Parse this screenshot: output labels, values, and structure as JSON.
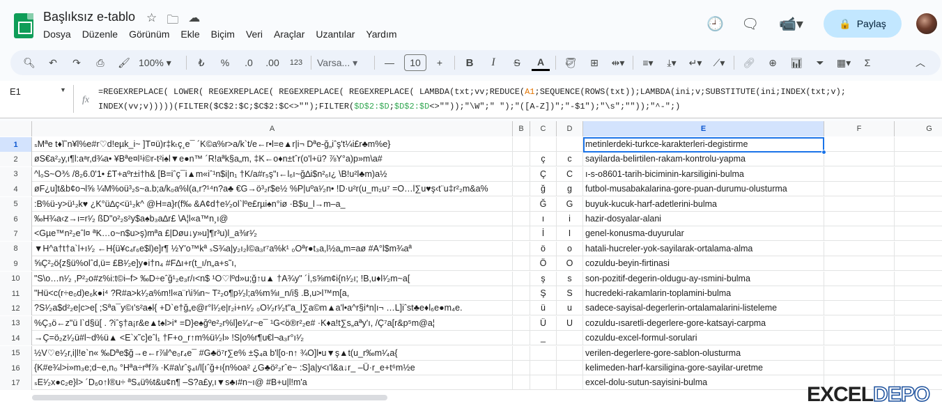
{
  "app": {
    "title": "Başlıksız e-tablo",
    "menus": [
      "Dosya",
      "Düzenle",
      "Görünüm",
      "Ekle",
      "Biçim",
      "Veri",
      "Araçlar",
      "Uzantılar",
      "Yardım"
    ],
    "share_label": "Paylaş"
  },
  "toolbar": {
    "zoom": "100%",
    "currency": "₺",
    "percent": "%",
    "dec_decrease": ".0",
    "dec_increase": ".00",
    "number_format": "123",
    "font": "Varsa...",
    "font_size": "10",
    "bold": "B",
    "italic": "I",
    "strike": "S",
    "text_color": "A"
  },
  "formula_bar": {
    "cell_ref": "E1",
    "fx": "fx",
    "line1_a": "=REGEXREPLACE( LOWER( REGEXREPLACE( REGEXREPLACE( REGEXREPLACE( LAMBDA(txt;vv;REDUCE(",
    "line1_ref": "A1",
    "line1_b": ";SEQUENCE(ROWS(txt));LAMBDA(ini;v;SUBSTITUTE(ini;INDEX(txt;v);",
    "line2_a": "INDEX(vv;v)))))(FILTER($C$2:$C;$C$2:$C<>\"\");FILTER(",
    "line2_ref1": "$D$2:$D",
    "line2_b": ";",
    "line2_ref2": "$D$2:$D",
    "line2_c": "<>\"\"));\"\\W\";\" \");\"([A-Z])\";\"-$1\");\"\\s\";\"\"));\"^-\";)"
  },
  "columns": [
    "A",
    "B",
    "C",
    "D",
    "E",
    "F",
    "G"
  ],
  "rows": [
    {
      "n": "1",
      "a": "ₛMªe t♦ĭˆn¥l%e#r♡d!eµk_i~ ]T¤ü)r‡kₜç¸e¯ ´K©a%r>a/k`t/e←r•l=e▲r|i¬ Dªe-ğ„iˆş't¼i£r♣m%e}",
      "c": "",
      "d": "",
      "e": "metinlerdeki-turkce-karakterleri-degistirme"
    },
    {
      "n": "2",
      "a": "øS€a²₂y,ı¶l:aᵃr,d¾a• ¥Bªe¤l¹i©r-t²i♠l▼e●n™ ´R!aªk§a„m, ‡K←o♦n±tˆr(o'l+ü? ⅞Y°a)p»m\\a#",
      "c": "ç",
      "d": "c",
      "e": "sayilarda-belirtilen-rakam-kontrolu-yapma"
    },
    {
      "n": "3",
      "a": "^l₀S~O⅗ /8₂6.0'1• £T+aºr±i†h& [B=iˆç¯i▲m«iˆ¹n$i|n₁ †K/a#r₅ş\"ı←l₆ı~ğ∆i$n²₆ı¿ \\B!u²l♣m)a½",
      "c": "Ç",
      "d": "C",
      "e": "ı-s-o8601-tarih-biciminin-karsiligini-bulma"
    },
    {
      "n": "4",
      "a": "øF¿u]t&b¢o¬l⅝ ¼M%oü³₂s~a.b;a/k₀a%l(a,r?¹⁴n?a♣ €G→ö³₂r$e½ %P|uºa¹⁄₂n• !D·u²r(u_m₂u⁷ =O…l∑u♥ş‹t¨u‡r²₂m&a%",
      "c": "ğ",
      "d": "g",
      "e": "futbol-musabakalarina-gore-puan-durumu-olusturma"
    },
    {
      "n": "5",
      "a": ":B%ü-y>ü¹₂k♥ ¿K°ü∆ç<ü¹₂k^ @H=a}r(f‰ &A¢d†e¹⁄₂ol`lºe£rµi♠n°iø ·B$u_l→m–a_",
      "c": "Ğ",
      "d": "G",
      "e": "buyuk-kucuk-harf-adetlerini-bulma"
    },
    {
      "n": "6",
      "a": "‰H¾a‹z→ı=r¹⁄₂ ßD\"o²₂s²y$a♠b₃a∆r£ \\A¦l«a™n¸ı@",
      "c": "ı",
      "d": "i",
      "e": "hazir-dosyalar-alani"
    },
    {
      "n": "7",
      "a": "<Gµe™n²₂eˆl¤ ªK…o~n$u>ş)mªa £|Døu↓y»u]¶r³u)l_a⅜r¹⁄₂",
      "c": "İ",
      "d": "I",
      "e": "genel-konusma-duyurular"
    },
    {
      "n": "8",
      "a": "▼H^a†t†a`l+ı¹⁄₂ ←H{ü¥c₄r₆e$l)e]r¶ ½Y'o™kª ₛS¾a|y₂ı₂l©a₃r⁷a%k¹ ₀Oªr●t₃a,l½a„m=aø #A°l$m¾aª",
      "c": "ö",
      "d": "o",
      "e": "hatali-hucreler-yok-sayilarak-ortalama-alma"
    },
    {
      "n": "9",
      "a": "⅝Ç²₂ö{z§ü%olˆd,ü= £B¹⁄₂e]y●i†n₄ #F∆ı+r(t_ı/n„a+s˜ı,",
      "c": "Ö",
      "d": "O",
      "e": "cozuldu-beyin-firtinasi"
    },
    {
      "n": "10",
      "a": "\"S\\o…n¹⁄₂ ,P²₂o#z%i:t©i–f> ‰D÷eˆğ¹₂e₃r/ı<n$ ¹O♡lºd»u;ğ↑u▲ †A¾y\" ´İ,s⅝m¢i{n¹⁄₂ı; !B,u♦l¹⁄₂m~a[",
      "c": "ş",
      "d": "s",
      "e": "son-pozitif-degerin-oldugu-ay-ısmini-bulma"
    },
    {
      "n": "11",
      "a": "\"Hü<c(r÷e₀d)e₆k●i⁴ ?R#a>k¹⁄₂a%m!l«a¨r\\i⅝n~ T²₂o¶p¹⁄₂l;a%m⅝ı_n/i§ .B,u>l™m[a,",
      "c": "Ş",
      "d": "S",
      "e": "hucredeki-rakamlarin-toplamini-bulma"
    },
    {
      "n": "12",
      "a": "?S¹⁄₂a$d²₂e|c>e[ ;Sªa¯y©ı's²a♠l{ +D`e†ğ„e@r°l¹⁄₂e|r₂i+n¹⁄₂ ₀O¹⁄₂r¹⁄₂t\"a_l∑a©m▲a'l•a^r§i*n|ı¬ …L]iˆst♣e♦l₆e●m₄e.",
      "c": "ü",
      "d": "u",
      "e": "sadece-sayisal-degerlerin-ortalamalarini-listeleme"
    },
    {
      "n": "13",
      "a": "%Ç₃ö←z\"ü l`d§ü[ . ?iˆş†a¡r&e▲t♠l>i* =D}e♠ğºe²₂r%l]e¹⁄₄r~e¯ ¹G<ö®r²₂e# ·K♦a!t∑s„aªy'ı, /Ç⁷a[r&p⁵m@a¦",
      "c": "Ü",
      "d": "U",
      "e": "cozuldu-ısaretli-degerlere-gore-katsayi-carpma"
    },
    {
      "n": "14",
      "a": "→Ç=ö₂z¹⁄₂ü#l~d%ü▲ <E`x˜c]eˆl₁ †F+o_r↑m%ü¹⁄₂l» !S|o%r¶u€l¬a₃r°ı¹⁄₂",
      "c": "_",
      "d": "",
      "e": "cozuldu-excel-formul-sorulari"
    },
    {
      "n": "15",
      "a": "½V♡e¹⁄₂r,i|l!e`n« ‰Dªe$ğ→e←r⅞l^e₀r₄e¯ #G♣ö⁷r∑e% ±Ş₄a b'l[o·n↑ ¾O]l•u▼ş▲t(u_r‰m¹⁄₄a{",
      "c": "",
      "d": "",
      "e": "verilen-degerlere-gore-sablon-olusturma"
    },
    {
      "n": "16",
      "a": "{K#e¾l>i»m₃e;d~e,n₀ °Hªa÷rªf⅞ ·K#a\\rˆş₄ı/l[ıˆğ+ı{n%oa² ¿G♣ö²₂rˆe~ :S]a|y<ı'l&a↓r_ –Ü·r_e+t⁶m½e",
      "c": "",
      "d": "",
      "e": "kelimeden-harf-karsiligina-gore-sayilar-uretme"
    },
    {
      "n": "17",
      "a": "ₛE¹⁄₂x●c₂e}l> ´D₆o↑l®u÷ ªS₄ü%t&u¢n¶ –S?a£y,ı▼s♣ı#n~ı@ #B+u|l!m'a",
      "c": "",
      "d": "",
      "e": "excel-dolu-sutun-sayisini-bulma"
    }
  ],
  "watermark": {
    "left": "EXCEL",
    "right": "DEPO"
  }
}
